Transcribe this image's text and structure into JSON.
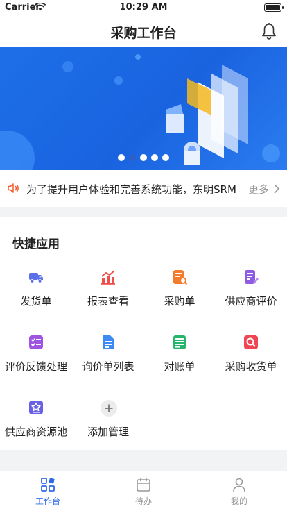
{
  "status_bar": {
    "carrier": "Carrier",
    "time": "10:29 AM"
  },
  "nav": {
    "title": "采购工作台"
  },
  "banner": {
    "pages": 5,
    "active_page": 2
  },
  "notice": {
    "text": "为了提升用户体验和完善系统功能，东明SRM",
    "more_label": "更多"
  },
  "quick_apps": {
    "title": "快捷应用",
    "items": [
      {
        "label": "发货单",
        "icon": "truck-icon",
        "color": "#5b6fe8"
      },
      {
        "label": "报表查看",
        "icon": "bar-chart-icon",
        "color": "#f0504c"
      },
      {
        "label": "采购单",
        "icon": "document-search-icon",
        "color": "#f57b2c"
      },
      {
        "label": "供应商评价",
        "icon": "document-edit-icon",
        "color": "#8f5be0"
      },
      {
        "label": "评价反馈处理",
        "icon": "checklist-icon",
        "color": "#a055e0"
      },
      {
        "label": "询价单列表",
        "icon": "file-list-icon",
        "color": "#3d8bf2"
      },
      {
        "label": "对账单",
        "icon": "ledger-icon",
        "color": "#27b56b"
      },
      {
        "label": "采购收货单",
        "icon": "search-receipt-icon",
        "color": "#f04552"
      },
      {
        "label": "供应商资源池",
        "icon": "star-box-icon",
        "color": "#6a60e6"
      },
      {
        "label": "添加管理",
        "icon": "plus-circle-icon",
        "color": "#c8c8c8"
      }
    ]
  },
  "tabbar": {
    "active_color": "#2f6ae6",
    "items": [
      {
        "label": "工作台",
        "icon": "grid-icon",
        "active": true
      },
      {
        "label": "待办",
        "icon": "calendar-icon",
        "active": false
      },
      {
        "label": "我的",
        "icon": "user-icon",
        "active": false
      }
    ]
  }
}
